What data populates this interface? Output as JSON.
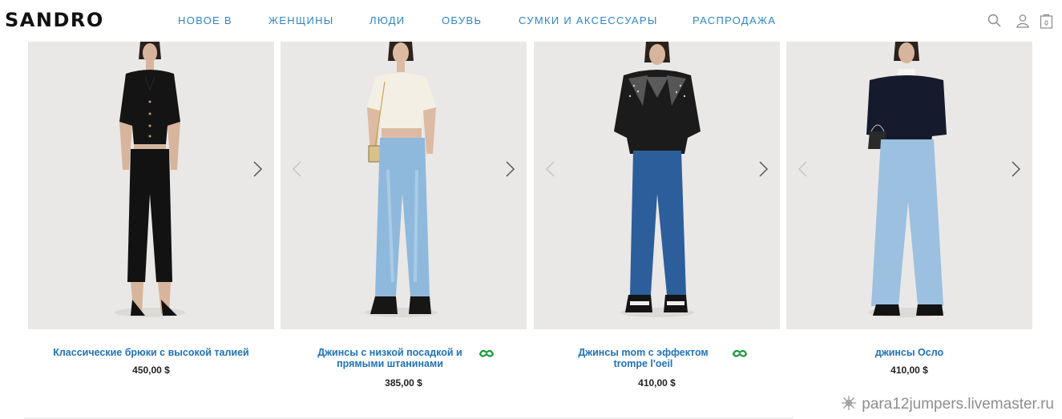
{
  "header": {
    "logo": "SANDRO",
    "nav": [
      "НОВОЕ В",
      "ЖЕНЩИНЫ",
      "ЛЮДИ",
      "ОБУВЬ",
      "СУМКИ И АКСЕССУАРЫ",
      "РАСПРОДАЖА"
    ],
    "icons": [
      "search-icon",
      "account-icon",
      "cart-icon"
    ],
    "cart_count": "0"
  },
  "products": [
    {
      "title": "Классические брюки с высокой талией",
      "price": "450,00 $",
      "eco_badge": false
    },
    {
      "title": "Джинсы с низкой посадкой и прямыми штанинами",
      "price": "385,00 $",
      "eco_badge": true
    },
    {
      "title": "Джинсы mom с эффектом trompe l'oeil",
      "price": "410,00 $",
      "eco_badge": true
    },
    {
      "title": "джинсы Осло",
      "price": "410,00 $",
      "eco_badge": false
    }
  ],
  "watermark": "para12jumpers.livemaster.ru",
  "colors": {
    "nav": "#2f86c4",
    "title": "#1f72b8",
    "eco": "#1a9a3a",
    "photo_bg": "#e9e8e6"
  }
}
